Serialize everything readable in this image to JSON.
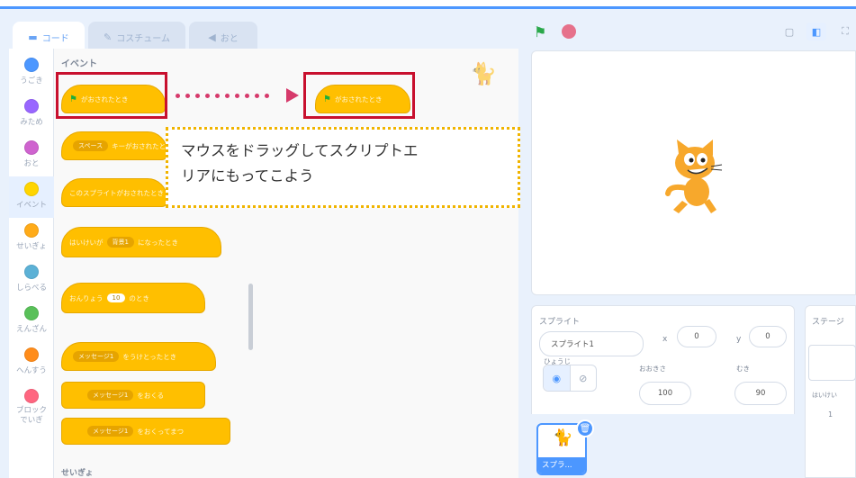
{
  "tabs": [
    {
      "label": "コード",
      "icon": "code-icon"
    },
    {
      "label": "コスチューム",
      "icon": "brush-icon"
    },
    {
      "label": "おと",
      "icon": "speaker-icon"
    }
  ],
  "categories": [
    {
      "label": "うごき",
      "color": "#4c97ff"
    },
    {
      "label": "みため",
      "color": "#9966ff"
    },
    {
      "label": "おと",
      "color": "#cf63cf"
    },
    {
      "label": "イベント",
      "color": "#ffd500"
    },
    {
      "label": "せいぎょ",
      "color": "#ffab19"
    },
    {
      "label": "しらべる",
      "color": "#5cb1d6"
    },
    {
      "label": "えんざん",
      "color": "#59c059"
    },
    {
      "label": "へんすう",
      "color": "#ff8c1a"
    },
    {
      "label": "ブロックでいぎ",
      "color": "#ff6680"
    }
  ],
  "palette": {
    "section_title": "イベント",
    "blocks": [
      {
        "text": "がおされたとき"
      },
      {
        "text": "スペース",
        "suffix": "キーがおされたとき"
      },
      {
        "text": "このスプライトがおされたとき"
      },
      {
        "text": "はいけいが",
        "dropdown": "背景1",
        "suffix": "になったとき"
      },
      {
        "text": "おんりょう",
        "value": "10",
        "suffix": "のとき"
      },
      {
        "text": "メッセージ1",
        "suffix": "をうけとったとき"
      },
      {
        "text": "メッセージ1",
        "suffix": "をおくる"
      },
      {
        "text": "メッセージ1",
        "suffix": "をおくってまつ"
      }
    ],
    "next_section": "せいぎょ"
  },
  "script_area": {
    "placed_block": "がおされたとき"
  },
  "callout": {
    "line1": "マウスをドラッグしてスクリプトエ",
    "line2": "リアにもってこよう"
  },
  "sprite_info": {
    "sprite_label": "スプライト",
    "sprite_name": "スプライト1",
    "x_label": "x",
    "x_value": "0",
    "y_label": "y",
    "y_value": "0",
    "show_label": "ひょうじ",
    "size_label": "おおきさ",
    "size_value": "100",
    "direction_label": "むき",
    "direction_value": "90"
  },
  "sprite_list": {
    "tile_label": "スプラ..."
  },
  "stage_panel": {
    "title": "ステージ",
    "backdrops_label": "はいけい",
    "backdrops_count": "1"
  },
  "colors": {
    "accent": "#4c97ff",
    "event_block": "#ffbf00",
    "annotation_red": "#c8102e",
    "callout_border": "#f0b400"
  }
}
